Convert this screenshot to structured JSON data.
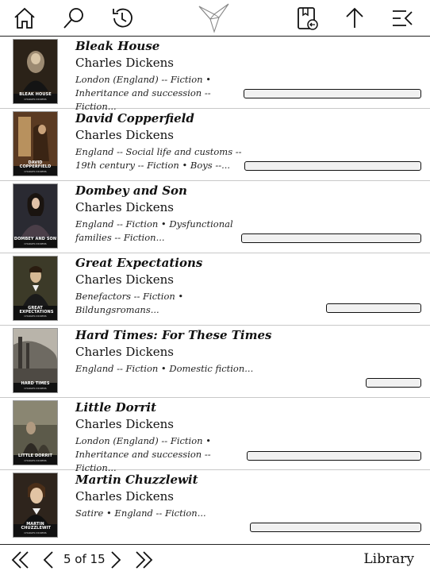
{
  "toolbar": {
    "icons": [
      "home-icon",
      "search-icon",
      "history-icon",
      "app-logo",
      "bookmark-back-icon",
      "up-arrow-icon",
      "menu-collapse-icon"
    ]
  },
  "books": [
    {
      "title": "Bleak House",
      "author": "Charles Dickens",
      "subjects": "London (England) -- Fiction • Inheritance and succession -- Fiction...",
      "cover_title": "BLEAK HOUSE",
      "cover_author": "CHARLES DICKENS",
      "progress": 0
    },
    {
      "title": "David Copperfield",
      "author": "Charles Dickens",
      "subjects": "England -- Social life and customs -- 19th century -- Fiction • Boys --...",
      "cover_title": "DAVID COPPERFIELD",
      "cover_author": "CHARLES DICKENS",
      "progress": 0
    },
    {
      "title": "Dombey and Son",
      "author": "Charles Dickens",
      "subjects": "England -- Fiction • Dysfunctional families -- Fiction...",
      "cover_title": "DOMBEY AND SON",
      "cover_author": "CHARLES DICKENS",
      "progress": 0
    },
    {
      "title": "Great Expectations",
      "author": "Charles Dickens",
      "subjects": "Benefactors -- Fiction • Bildungsromans...",
      "cover_title": "GREAT EXPECTATIONS",
      "cover_author": "CHARLES DICKENS",
      "progress": 0
    },
    {
      "title": "Hard Times: For These Times",
      "author": "Charles Dickens",
      "subjects": "England -- Fiction • Domestic fiction...",
      "cover_title": "HARD TIMES",
      "cover_author": "CHARLES DICKENS",
      "progress": 0
    },
    {
      "title": "Little Dorrit",
      "author": "Charles Dickens",
      "subjects": "London (England) -- Fiction • Inheritance and succession -- Fiction...",
      "cover_title": "LITTLE DORRIT",
      "cover_author": "CHARLES DICKENS",
      "progress": 0
    },
    {
      "title": "Martin Chuzzlewit",
      "author": "Charles Dickens",
      "subjects": "Satire • England -- Fiction...",
      "cover_title": "MARTIN CHUZZLEWIT",
      "cover_author": "CHARLES DICKENS",
      "progress": 0
    }
  ],
  "pagination": {
    "page_text": "5 of 15",
    "library_label": "Library"
  },
  "colors": {
    "progress_fill": "#f1f1f1",
    "border": "#111111"
  }
}
